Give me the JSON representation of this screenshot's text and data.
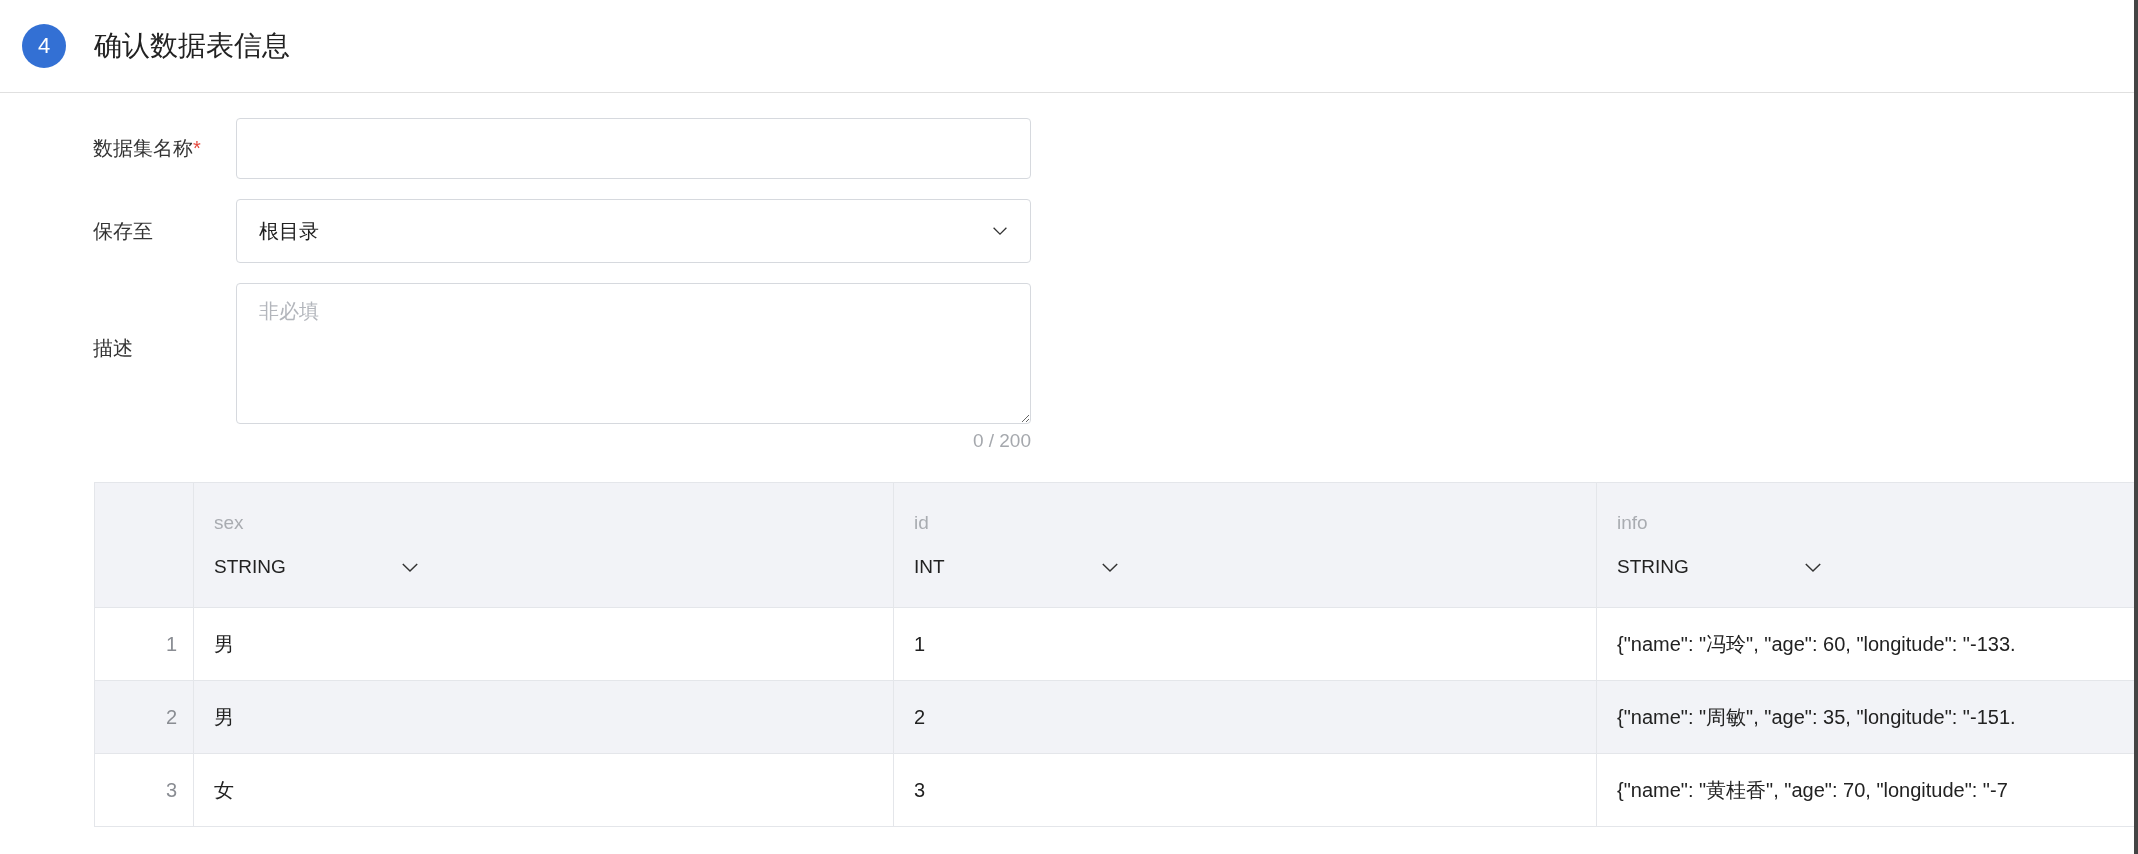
{
  "step": {
    "number": "4",
    "title": "确认数据表信息"
  },
  "form": {
    "fields": [
      {
        "kind": "text",
        "label": "数据集名称",
        "required_mark": "*"
      },
      {
        "kind": "select",
        "label": "保存至",
        "value": "根目录"
      },
      {
        "kind": "textarea",
        "label": "描述",
        "placeholder": "非必填",
        "counter": "0 / 200"
      }
    ]
  },
  "table": {
    "columns": [
      {
        "name": "sex",
        "type": "STRING"
      },
      {
        "name": "id",
        "type": "INT"
      },
      {
        "name": "info",
        "type": "STRING"
      }
    ],
    "rows": [
      {
        "index": "1",
        "cells": [
          "男",
          "1",
          "{\"name\": \"冯玲\", \"age\": 60, \"longitude\": \"-133."
        ]
      },
      {
        "index": "2",
        "cells": [
          "男",
          "2",
          "{\"name\": \"周敏\", \"age\": 35, \"longitude\": \"-151."
        ]
      },
      {
        "index": "3",
        "cells": [
          "女",
          "3",
          "{\"name\": \"黄桂香\", \"age\": 70, \"longitude\": \"-7"
        ]
      }
    ]
  }
}
